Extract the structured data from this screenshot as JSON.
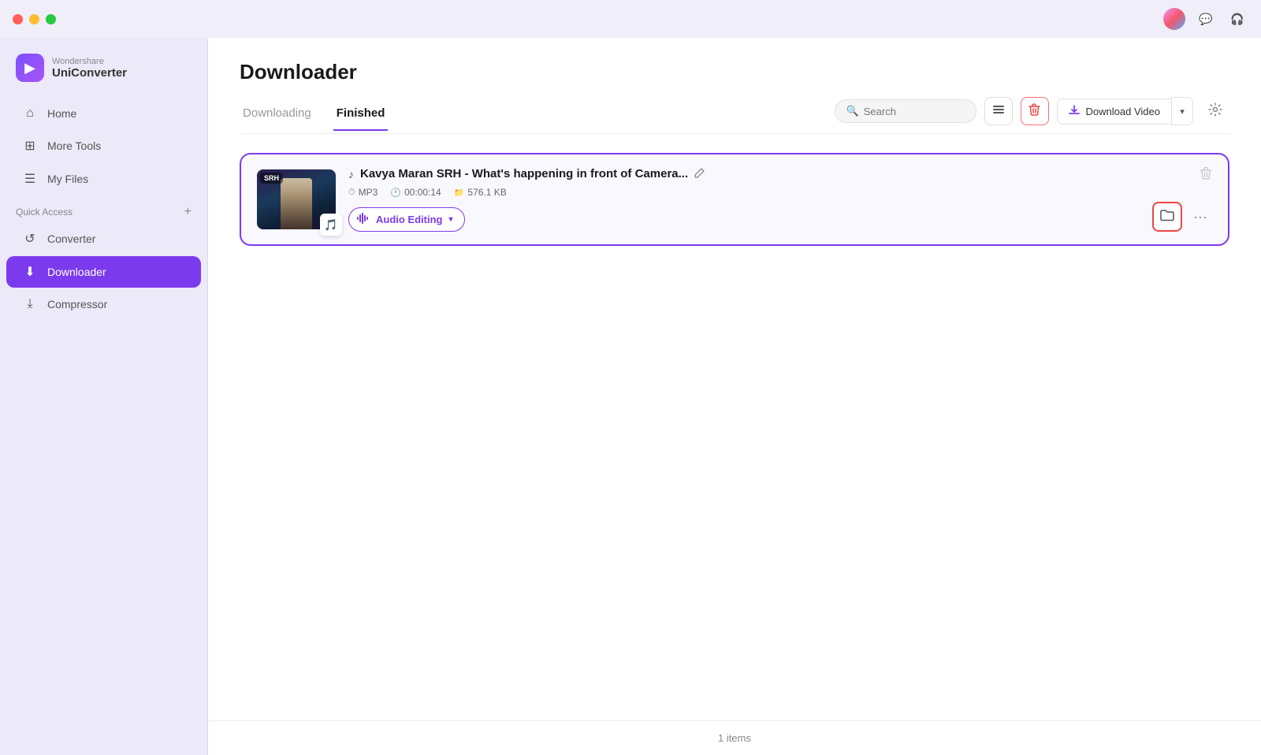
{
  "titlebar": {
    "controls": [
      "close",
      "minimize",
      "maximize"
    ],
    "right_icons": [
      "avatar",
      "chat",
      "headphone"
    ]
  },
  "sidebar": {
    "logo": {
      "brand": "Wondershare",
      "name": "UniConverter"
    },
    "nav_items": [
      {
        "id": "home",
        "label": "Home",
        "icon": "⌂"
      },
      {
        "id": "more-tools",
        "label": "More Tools",
        "icon": "⊞"
      },
      {
        "id": "my-files",
        "label": "My Files",
        "icon": "☰"
      }
    ],
    "quick_access_label": "Quick Access",
    "quick_access_items": [
      {
        "id": "converter",
        "label": "Converter",
        "icon": "↺"
      },
      {
        "id": "downloader",
        "label": "Downloader",
        "icon": "⬇",
        "active": true
      },
      {
        "id": "compressor",
        "label": "Compressor",
        "icon": "⤓"
      }
    ]
  },
  "page": {
    "title": "Downloader",
    "tabs": [
      {
        "id": "downloading",
        "label": "Downloading",
        "active": false
      },
      {
        "id": "finished",
        "label": "Finished",
        "active": true
      }
    ]
  },
  "toolbar": {
    "search_placeholder": "Search",
    "list_view_icon": "list",
    "delete_icon": "trash",
    "download_video_label": "Download Video",
    "settings_icon": "gear"
  },
  "files": [
    {
      "id": "file-1",
      "title": "Kavya Maran SRH - What's happening in front of Camera...",
      "format": "MP3",
      "duration": "00:00:14",
      "size": "576.1 KB",
      "audio_edit_label": "Audio Editing"
    }
  ],
  "footer": {
    "count_label": "1 items"
  }
}
